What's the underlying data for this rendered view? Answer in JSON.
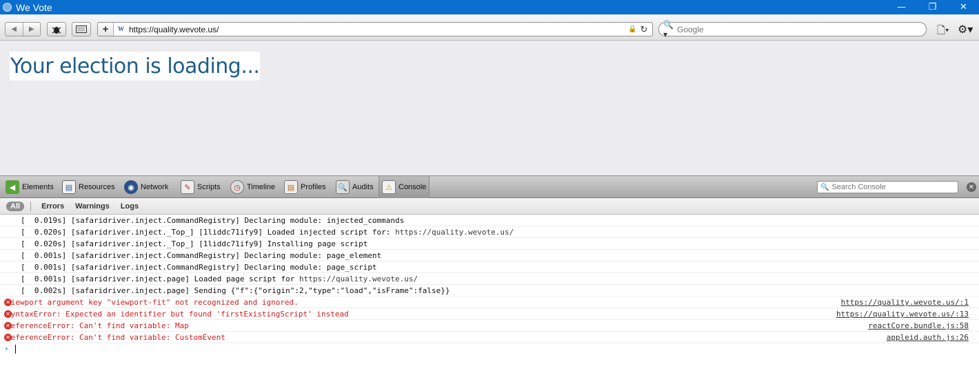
{
  "window": {
    "title": "We Vote",
    "controls": [
      "minimize",
      "restore",
      "close"
    ]
  },
  "toolbar": {
    "url": "https://quality.wevote.us/",
    "search_placeholder": "Google",
    "add_label": "+",
    "favicon_letter": "W"
  },
  "page": {
    "loading_text": "Your election is loading..."
  },
  "inspector": {
    "tabs": [
      {
        "label": "Elements",
        "icon": "elements-icon"
      },
      {
        "label": "Resources",
        "icon": "resources-icon"
      },
      {
        "label": "Network",
        "icon": "network-icon"
      },
      {
        "label": "Scripts",
        "icon": "scripts-icon"
      },
      {
        "label": "Timeline",
        "icon": "timeline-icon"
      },
      {
        "label": "Profiles",
        "icon": "profiles-icon"
      },
      {
        "label": "Audits",
        "icon": "audits-icon"
      },
      {
        "label": "Console",
        "icon": "console-icon"
      }
    ],
    "active_tab": "Console",
    "search_placeholder": "Search Console"
  },
  "filters": {
    "all": "All",
    "errors": "Errors",
    "warnings": "Warnings",
    "logs": "Logs"
  },
  "console": {
    "logs": [
      {
        "text": "[  0.019s] [safaridriver.inject.CommandRegistry] Declaring module: injected_commands",
        "link": ""
      },
      {
        "text": "[  0.020s] [safaridriver.inject._Top_] [1liddc71ify9] Loaded injected script for: ",
        "link": "https://quality.wevote.us/"
      },
      {
        "text": "[  0.020s] [safaridriver.inject._Top_] [1liddc71ify9] Installing page script",
        "link": ""
      },
      {
        "text": "[  0.001s] [safaridriver.inject.CommandRegistry] Declaring module: page_element",
        "link": ""
      },
      {
        "text": "[  0.001s] [safaridriver.inject.CommandRegistry] Declaring module: page_script",
        "link": ""
      },
      {
        "text": "[  0.001s] [safaridriver.inject.page] Loaded page script for ",
        "link": "https://quality.wevote.us/"
      },
      {
        "text": "[  0.002s] [safaridriver.inject.page] Sending {\"f\":{\"origin\":2,\"type\":\"load\",\"isFrame\":false}}",
        "link": ""
      }
    ],
    "errors": [
      {
        "text": "Viewport argument key \"viewport-fit\" not recognized and ignored.",
        "source": "https://quality.wevote.us/:1"
      },
      {
        "text": "SyntaxError: Expected an identifier but found 'firstExistingScript' instead",
        "source": "https://quality.wevote.us/:13"
      },
      {
        "text": "ReferenceError: Can't find variable: Map",
        "source": "reactCore.bundle.js:58"
      },
      {
        "text": "ReferenceError: Can't find variable: CustomEvent",
        "source": "appleid.auth.js:26"
      }
    ],
    "prompt_symbol": "›"
  },
  "colors": {
    "titlebar": "#0a6fcf",
    "loading_text": "#1f5d87",
    "error_text": "#d21d1d"
  }
}
